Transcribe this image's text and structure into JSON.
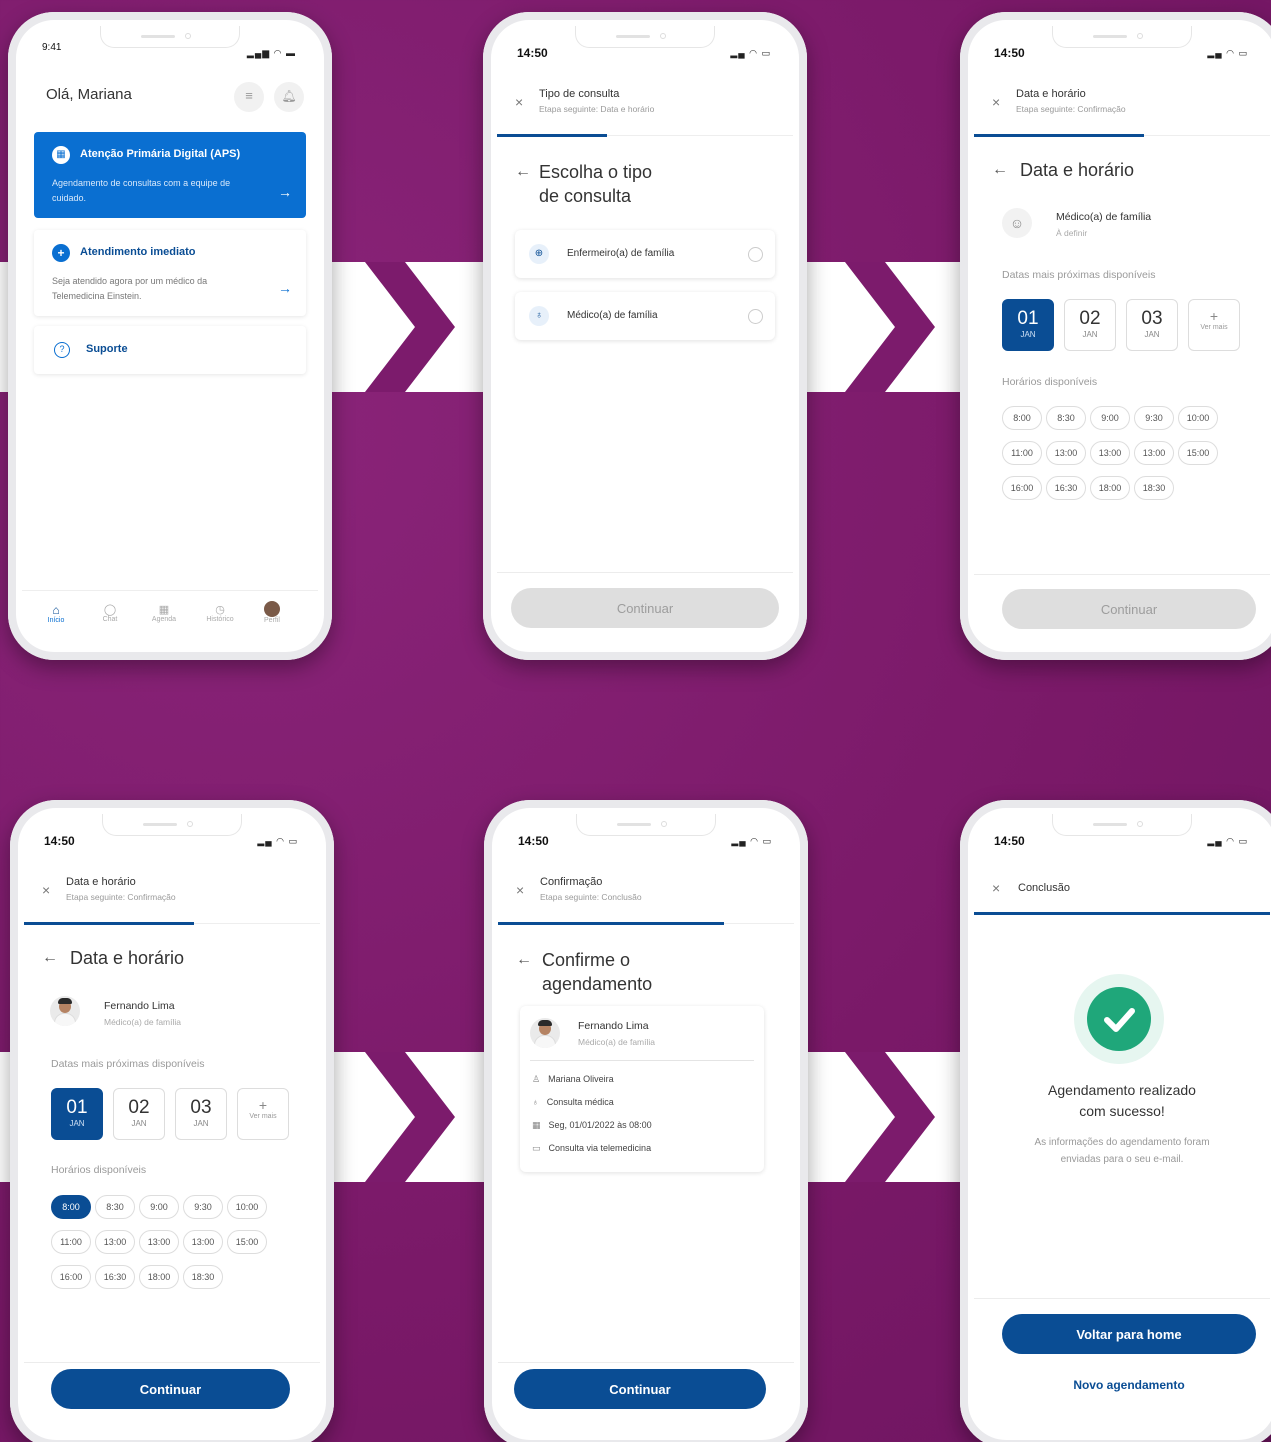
{
  "colors": {
    "background": "#7c1b6c",
    "primary": "#0a4d94",
    "success": "#1fa77a"
  },
  "phone1": {
    "time": "9:41",
    "greeting": "Olá, Mariana",
    "aps": {
      "title": "Atenção Primária Digital (APS)",
      "desc": "Agendamento de consultas com a equipe de cuidado."
    },
    "imediato": {
      "title": "Atendimento imediato",
      "desc": "Seja atendido agora por um médico da Telemedicina Einstein."
    },
    "suporte": "Suporte",
    "nav": [
      "Início",
      "Chat",
      "Agenda",
      "Histórico",
      "Perfil"
    ]
  },
  "phone2": {
    "time": "14:50",
    "header_title": "Tipo de consulta",
    "header_sub": "Etapa seguinte: Data e horário",
    "title_l1": "Escolha o tipo",
    "title_l2": "de consulta",
    "options": [
      "Enfermeiro(a) de família",
      "Médico(a) de família"
    ],
    "button": "Continuar"
  },
  "phone3": {
    "time": "14:50",
    "header_title": "Data e horário",
    "header_sub": "Etapa seguinte: Confirmação",
    "title": "Data e horário",
    "prof_name": "Médico(a) de família",
    "prof_sub": "À definir",
    "dates_label": "Datas mais próximas disponíveis",
    "dates": [
      {
        "d": "01",
        "m": "JAN"
      },
      {
        "d": "02",
        "m": "JAN"
      },
      {
        "d": "03",
        "m": "JAN"
      }
    ],
    "more_symbol": "+",
    "more": "Ver mais",
    "times_label": "Horários disponíveis",
    "times": [
      "8:00",
      "8:30",
      "9:00",
      "9:30",
      "10:00",
      "11:00",
      "13:00",
      "13:00",
      "13:00",
      "15:00",
      "16:00",
      "16:30",
      "18:00",
      "18:30"
    ],
    "button": "Continuar"
  },
  "phone4": {
    "time": "14:50",
    "header_title": "Data e horário",
    "header_sub": "Etapa seguinte: Confirmação",
    "title": "Data e horário",
    "prof_name": "Fernando Lima",
    "prof_sub": "Médico(a) de família",
    "dates_label": "Datas mais próximas disponíveis",
    "dates": [
      {
        "d": "01",
        "m": "JAN"
      },
      {
        "d": "02",
        "m": "JAN"
      },
      {
        "d": "03",
        "m": "JAN"
      }
    ],
    "more_symbol": "+",
    "more": "Ver mais",
    "times_label": "Horários disponíveis",
    "times": [
      "8:00",
      "8:30",
      "9:00",
      "9:30",
      "10:00",
      "11:00",
      "13:00",
      "13:00",
      "13:00",
      "15:00",
      "16:00",
      "16:30",
      "18:00",
      "18:30"
    ],
    "button": "Continuar"
  },
  "phone5": {
    "time": "14:50",
    "header_title": "Confirmação",
    "header_sub": "Etapa seguinte: Conclusão",
    "title_l1": "Confirme o",
    "title_l2": "agendamento",
    "prof_name": "Fernando Lima",
    "prof_sub": "Médico(a) de família",
    "details": [
      "Mariana Oliveira",
      "Consulta médica",
      "Seg, 01/01/2022 às 08:00",
      "Consulta via telemedicina"
    ],
    "button": "Continuar"
  },
  "phone6": {
    "time": "14:50",
    "header_title": "Conclusão",
    "success_l1": "Agendamento realizado",
    "success_l2": "com sucesso!",
    "info_l1": "As informações do agendamento foram",
    "info_l2": "enviadas para o seu e-mail.",
    "btn_home": "Voltar para home",
    "btn_new": "Novo agendamento"
  }
}
